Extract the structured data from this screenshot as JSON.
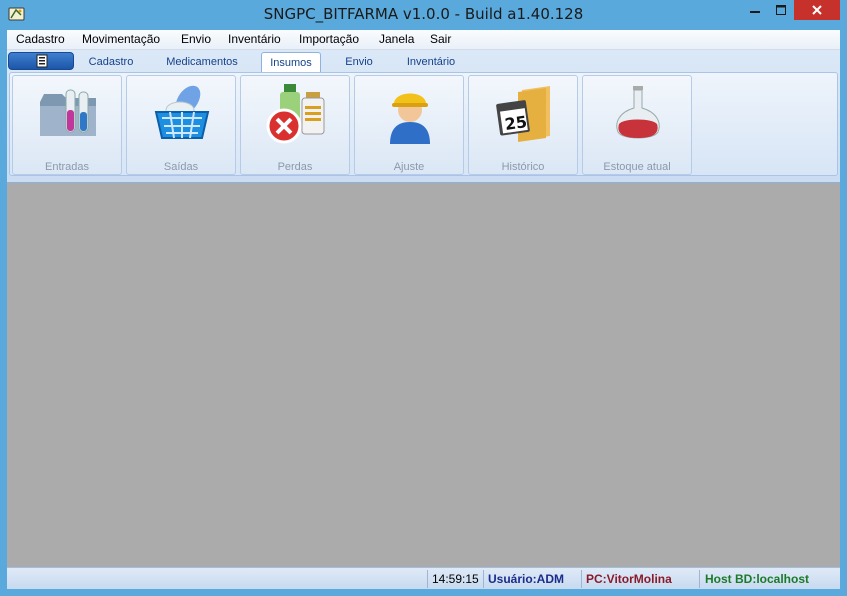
{
  "window": {
    "title": "SNGPC_BITFARMA v1.0.0 - Build a1.40.128"
  },
  "menu": [
    {
      "label": "Cadastro"
    },
    {
      "label": "Movimentação"
    },
    {
      "label": "Envio"
    },
    {
      "label": "Inventário"
    },
    {
      "label": "Importação"
    },
    {
      "label": "Janela"
    },
    {
      "label": "Sair"
    }
  ],
  "ribbon": {
    "app_button_icon": "document-list-icon",
    "tabs": [
      {
        "label": "Cadastro"
      },
      {
        "label": "Medicamentos"
      },
      {
        "label": "Insumos",
        "active": true
      },
      {
        "label": "Envio"
      },
      {
        "label": "Inventário"
      }
    ],
    "buttons": [
      {
        "label": "Entradas",
        "icon": "folder-test-tubes-icon"
      },
      {
        "label": "Saídas",
        "icon": "shopping-basket-icon"
      },
      {
        "label": "Perdas",
        "icon": "bottles-delete-icon"
      },
      {
        "label": "Ajuste",
        "icon": "worker-hardhat-icon"
      },
      {
        "label": "Histórico",
        "icon": "calendar-folder-icon"
      },
      {
        "label": "Estoque atual",
        "icon": "flask-icon"
      }
    ]
  },
  "calendar_day": "25",
  "status": {
    "time": "14:59:15",
    "user": "Usuário:ADM",
    "pc": "PC:VitorMolina",
    "host": "Host BD:localhost"
  },
  "colors": {
    "titlebar": "#5aa9dc",
    "close_button": "#c7312b",
    "workspace": "#ababab",
    "user_text": "#1a2c8c",
    "pc_text": "#8a1a2a",
    "host_text": "#1a7a2a"
  }
}
